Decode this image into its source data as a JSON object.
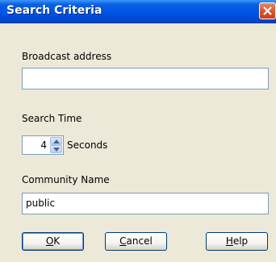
{
  "window": {
    "title": "Search Criteria"
  },
  "broadcast": {
    "label": "Broadcast address",
    "value": ""
  },
  "search_time": {
    "label": "Search Time",
    "value": "4",
    "unit": "Seconds"
  },
  "community": {
    "label": "Community Name",
    "value": "public"
  },
  "buttons": {
    "ok_mnemonic": "O",
    "ok_rest": "K",
    "cancel_mnemonic": "C",
    "cancel_rest": "ancel",
    "help_mnemonic": "H",
    "help_rest": "elp"
  },
  "icons": {
    "close": "close-icon",
    "spin_up": "chevron-up-icon",
    "spin_down": "chevron-down-icon"
  },
  "colors": {
    "titlebar": "#0055e5",
    "close_button": "#e05a2e",
    "dialog_background": "#ece9d8",
    "field_border": "#7f9db9"
  }
}
